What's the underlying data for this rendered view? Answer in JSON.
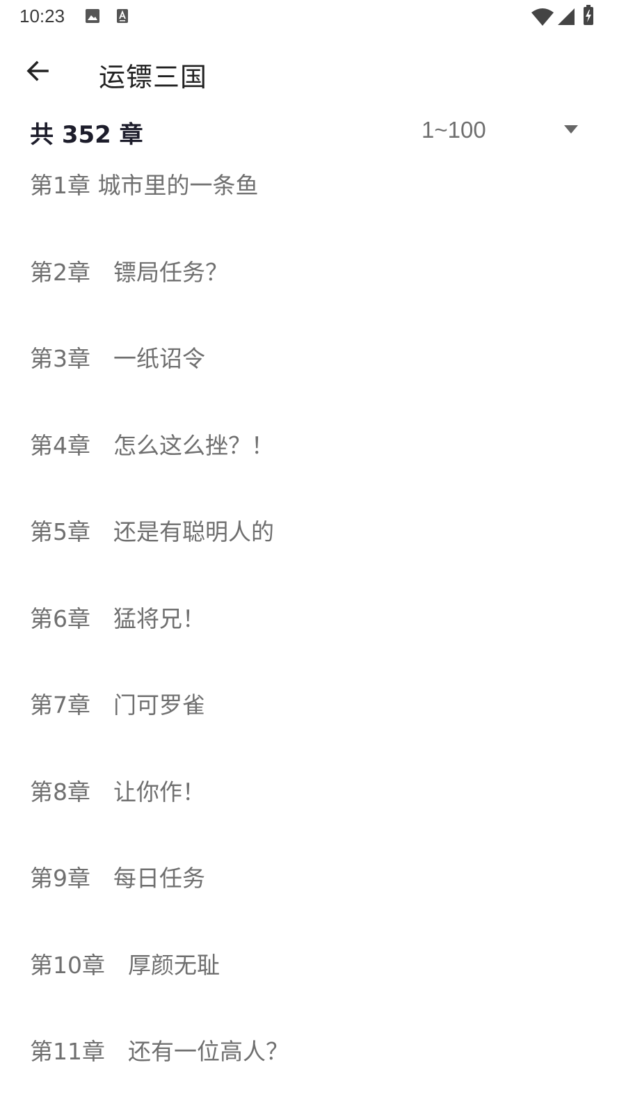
{
  "status_bar": {
    "time": "10:23",
    "icons": [
      "image-icon",
      "a-icon",
      "wifi-icon",
      "signal-icon",
      "battery-icon"
    ]
  },
  "app_bar": {
    "title": "运镖三国",
    "back_icon": "arrow-left-icon"
  },
  "header": {
    "count_label": "共 352 章",
    "range_selected": "1~100",
    "dropdown_icon": "triangle-down-icon"
  },
  "chapters": [
    {
      "label": "第1章 城市里的一条鱼"
    },
    {
      "label": "第2章　镖局任务？"
    },
    {
      "label": "第3章　一纸诏令"
    },
    {
      "label": "第4章　怎么这么挫？！"
    },
    {
      "label": "第5章　还是有聪明人的"
    },
    {
      "label": "第6章　猛将兄！"
    },
    {
      "label": "第7章　门可罗雀"
    },
    {
      "label": "第8章　让你作！"
    },
    {
      "label": "第9章　每日任务"
    },
    {
      "label": "第10章　厚颜无耻"
    },
    {
      "label": "第11章　还有一位高人？"
    }
  ],
  "colors": {
    "title_text": "#222222",
    "header_text": "#1d1d2b",
    "item_text": "#6f6f6f",
    "background": "#ffffff"
  }
}
